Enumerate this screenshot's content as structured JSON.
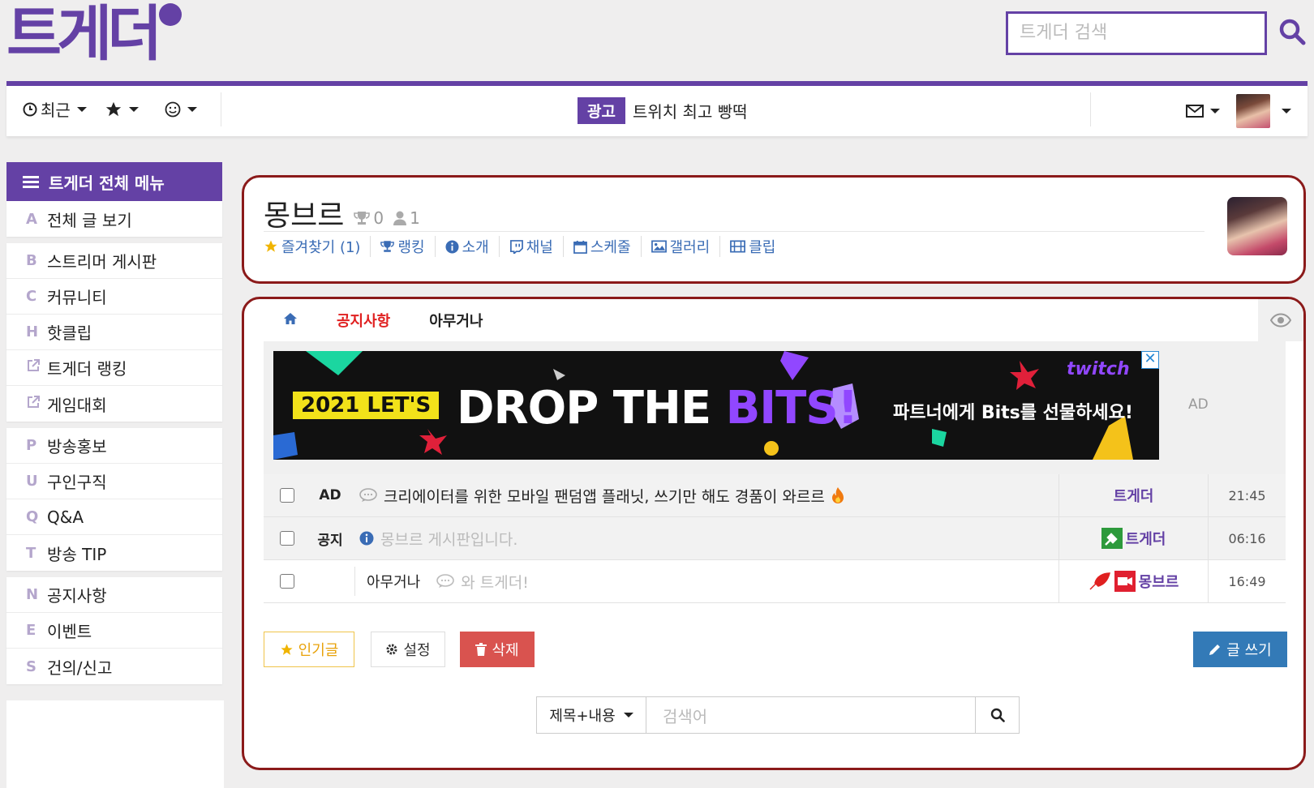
{
  "logo": {
    "text": "트게더"
  },
  "header": {
    "search_placeholder": "트게더 검색"
  },
  "navbar": {
    "recent_label": "최근",
    "ad_badge": "광고",
    "ad_text": "트위치 최고 빵떡"
  },
  "sidebar": {
    "title": "트게더 전체 메뉴",
    "groups": [
      [
        {
          "letter": "A",
          "label": "전체 글 보기"
        }
      ],
      [
        {
          "letter": "B",
          "label": "스트리머 게시판"
        },
        {
          "letter": "C",
          "label": "커뮤니티"
        },
        {
          "letter": "H",
          "label": "핫클립"
        },
        {
          "letter": "",
          "label": "트게더 랭킹"
        },
        {
          "letter": "",
          "label": "게임대회"
        }
      ],
      [
        {
          "letter": "P",
          "label": "방송홍보"
        },
        {
          "letter": "U",
          "label": "구인구직"
        },
        {
          "letter": "Q",
          "label": "Q&A"
        },
        {
          "letter": "T",
          "label": "방송 TIP"
        }
      ],
      [
        {
          "letter": "N",
          "label": "공지사항"
        },
        {
          "letter": "E",
          "label": "이벤트"
        },
        {
          "letter": "S",
          "label": "건의/신고"
        }
      ]
    ]
  },
  "board": {
    "title": "몽브르",
    "trophy_count": "0",
    "user_count": "1",
    "menu": [
      "즐겨찾기 (1)",
      "랭킹",
      "소개",
      "채널",
      "스케줄",
      "갤러리",
      "클립"
    ]
  },
  "tabs": {
    "notice": "공지사항",
    "misc": "아무거나"
  },
  "ad_banner": {
    "year": "2021 LET'S",
    "main_prefix": "DROP THE ",
    "main_bits": "BITS!",
    "sub": "파트너에게 Bits를 선물하세요!",
    "brand": "twitch",
    "close": "✕",
    "label": "AD"
  },
  "posts": [
    {
      "type": "AD",
      "category": "",
      "title": "크리에이터를 위한 모바일 팬덤앱 플래닛, 쓰기만 해도 경품이 와르르",
      "author": "트게더",
      "time": "21:45"
    },
    {
      "type": "공지",
      "category": "",
      "title": "몽브르 게시판입니다.",
      "author": "트게더",
      "time": "06:16"
    },
    {
      "type": "",
      "category": "아무거나",
      "title": "와 트게더!",
      "author": "몽브르",
      "time": "16:49"
    }
  ],
  "buttons": {
    "popular": "인기글",
    "settings": "설정",
    "delete": "삭제",
    "write": "글 쓰기"
  },
  "search": {
    "select_value": "제목+내용",
    "placeholder": "검색어"
  },
  "colors": {
    "brand": "#6441a5",
    "panel_border": "#8b1a1a",
    "notice": "#e02020",
    "link": "#3a6cb5"
  }
}
